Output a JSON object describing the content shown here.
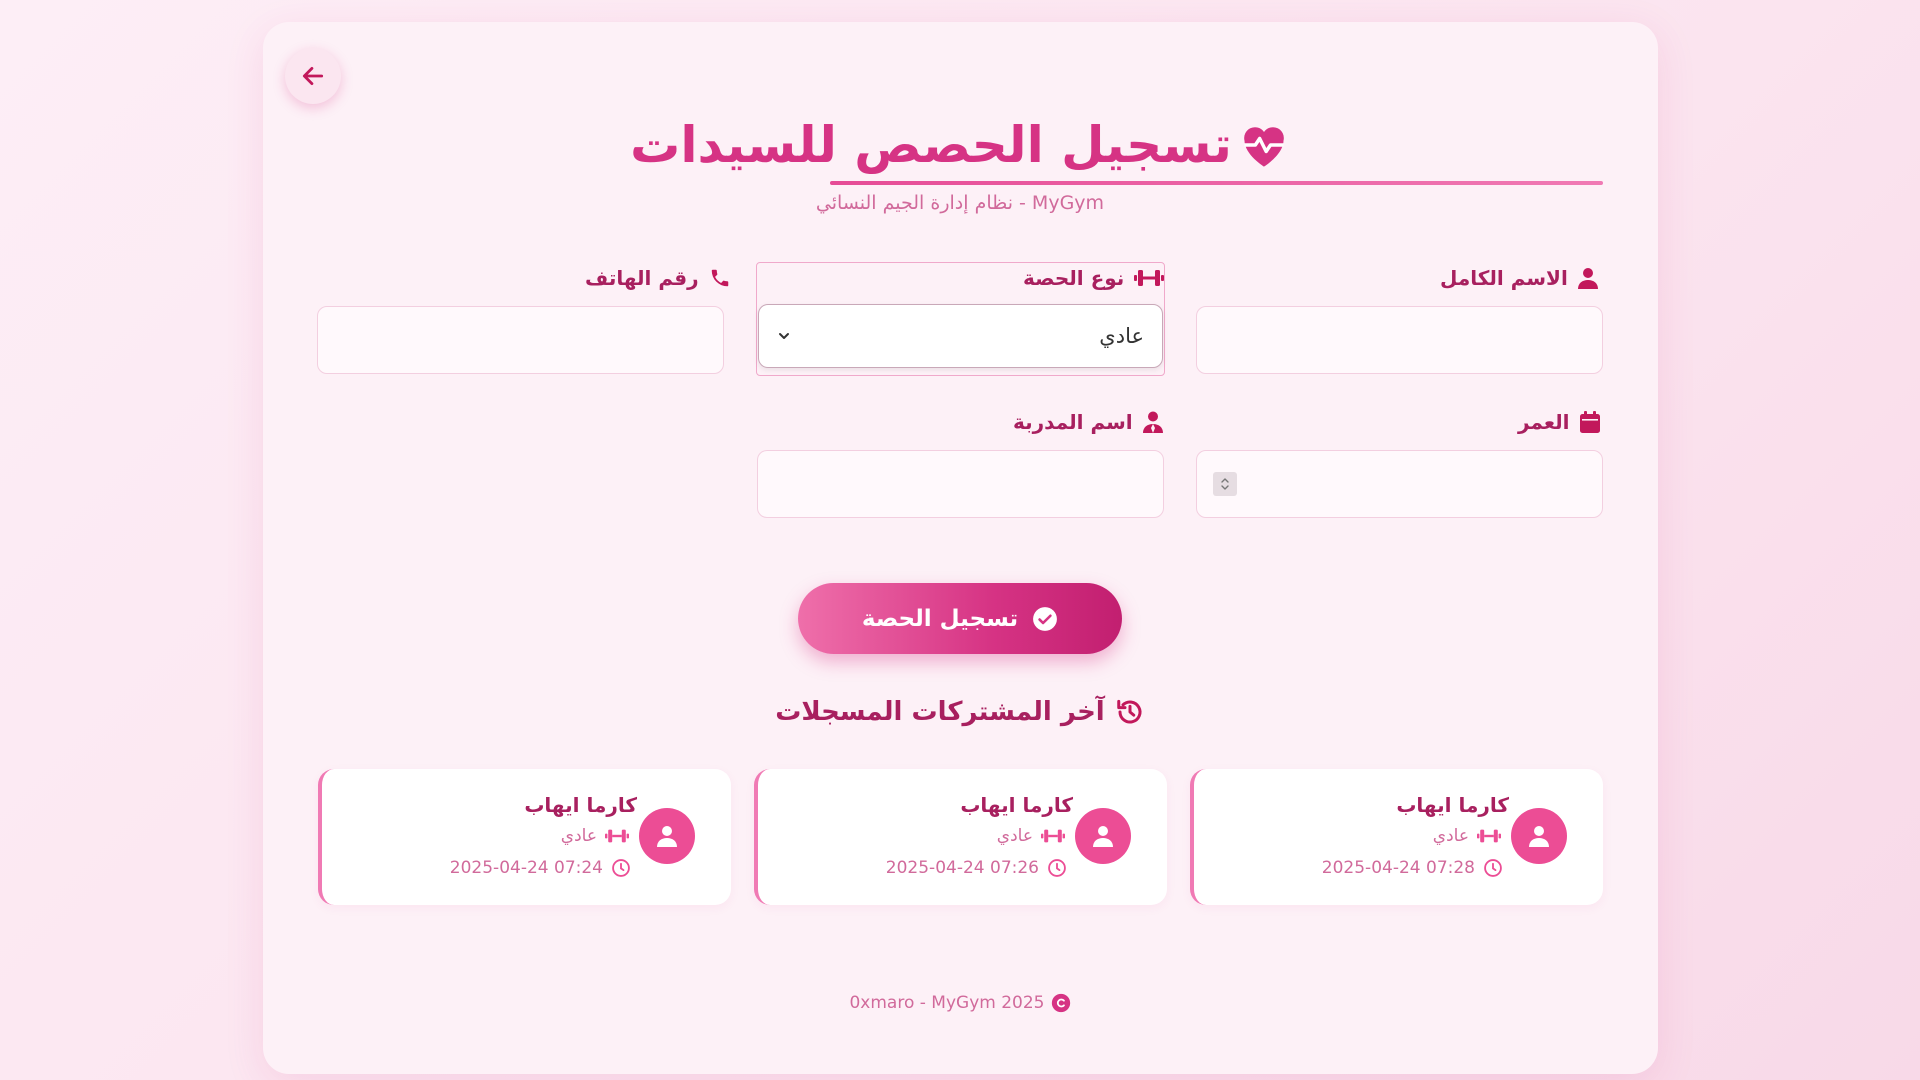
{
  "header": {
    "title": "تسجيل الحصص للسيدات",
    "subtitle": "نظام إدارة الجيم النسائي - MyGym"
  },
  "form": {
    "full_name_label": "الاسم الكامل",
    "session_type_label": "نوع الحصة",
    "session_type_value": "عادي",
    "phone_label": "رقم الهاتف",
    "age_label": "العمر",
    "trainer_label": "اسم المدربة",
    "submit_label": "تسجيل الحصة"
  },
  "recent": {
    "title": "آخر المشتركات المسجلات",
    "members": [
      {
        "name": "كارما ايهاب",
        "type": "عادي",
        "datetime": "2025-04-24 07:28"
      },
      {
        "name": "كارما ايهاب",
        "type": "عادي",
        "datetime": "2025-04-24 07:26"
      },
      {
        "name": "كارما ايهاب",
        "type": "عادي",
        "datetime": "2025-04-24 07:24"
      }
    ]
  },
  "footer": {
    "text": "0xmaro - MyGym 2025"
  },
  "colors": {
    "accent": "#d63384",
    "label": "#a8205f",
    "muted": "#d16a9b",
    "background": "#fdf1f7"
  },
  "icons": [
    "arrow-left-icon",
    "heart-pulse-icon",
    "user-icon",
    "dumbbell-icon",
    "phone-icon",
    "calendar-icon",
    "trainer-icon",
    "check-circle-icon",
    "history-icon",
    "clock-icon",
    "copyright-icon",
    "chevron-down-icon"
  ]
}
